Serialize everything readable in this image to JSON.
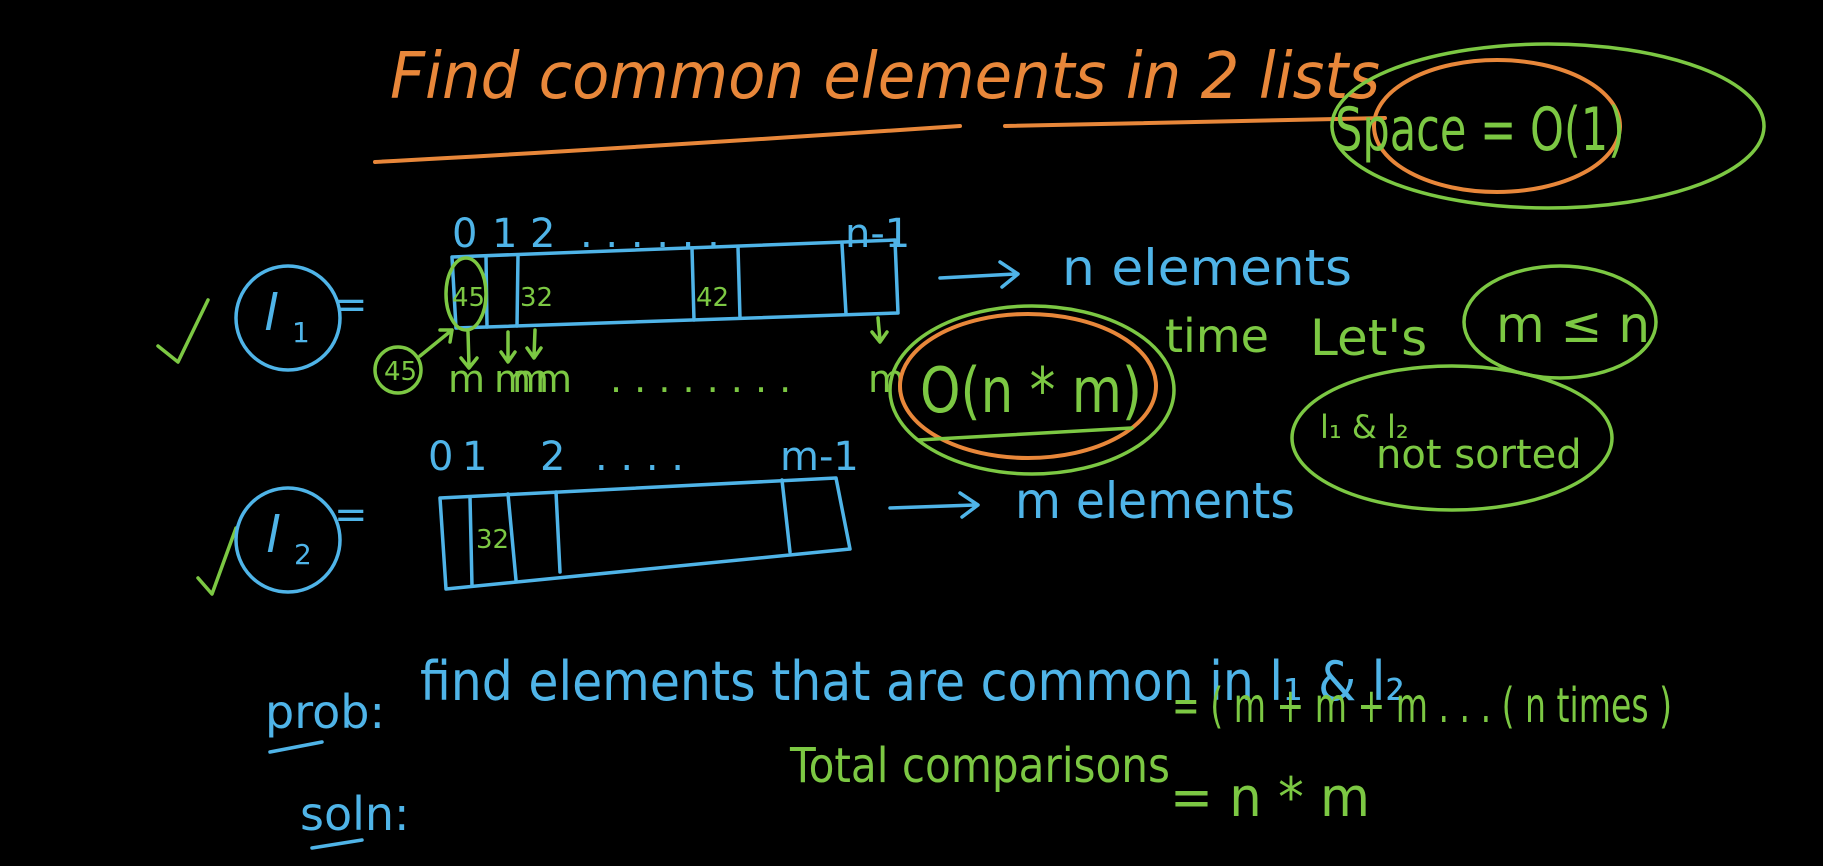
{
  "title": "Find common elements in 2 lists",
  "space_note": "Space = O(1)",
  "list1": {
    "name": "l",
    "subscript": "1",
    "eq": "=",
    "indices": [
      "0",
      "1",
      "2",
      ". . . . . .",
      "n-1"
    ],
    "cells": [
      "45",
      "32",
      "42"
    ],
    "length_note": "n elements",
    "pointer": "45",
    "compare_marks": [
      "m",
      "m",
      "m",
      "m",
      ". . . . . . . .",
      "m"
    ]
  },
  "list2": {
    "name": "l",
    "subscript": "2",
    "eq": "=",
    "indices": [
      "0",
      "1",
      "2",
      ". . . .",
      "m-1"
    ],
    "cells": [
      "32"
    ],
    "length_note": "m elements"
  },
  "time_complexity": {
    "big_o": "O(n * m)",
    "label": "time"
  },
  "assumptions": {
    "lets": "Let's",
    "relation": "m ≤ n",
    "sorted_line1": "l₁ & l₂",
    "sorted_line2": "not sorted"
  },
  "problem": {
    "label": "prob:",
    "text": "find elements that are common in l₁ & l₂"
  },
  "solution": {
    "label": "soln:",
    "comparisons_label": "Total comparisons",
    "comparisons_sum": "= ( m + m + m . . . ( n times )",
    "comparisons_result": "= n * m"
  },
  "colors": {
    "background": "#000000",
    "orange": "#e8873a",
    "blue": "#4fb4e8",
    "green": "#7cc843"
  }
}
